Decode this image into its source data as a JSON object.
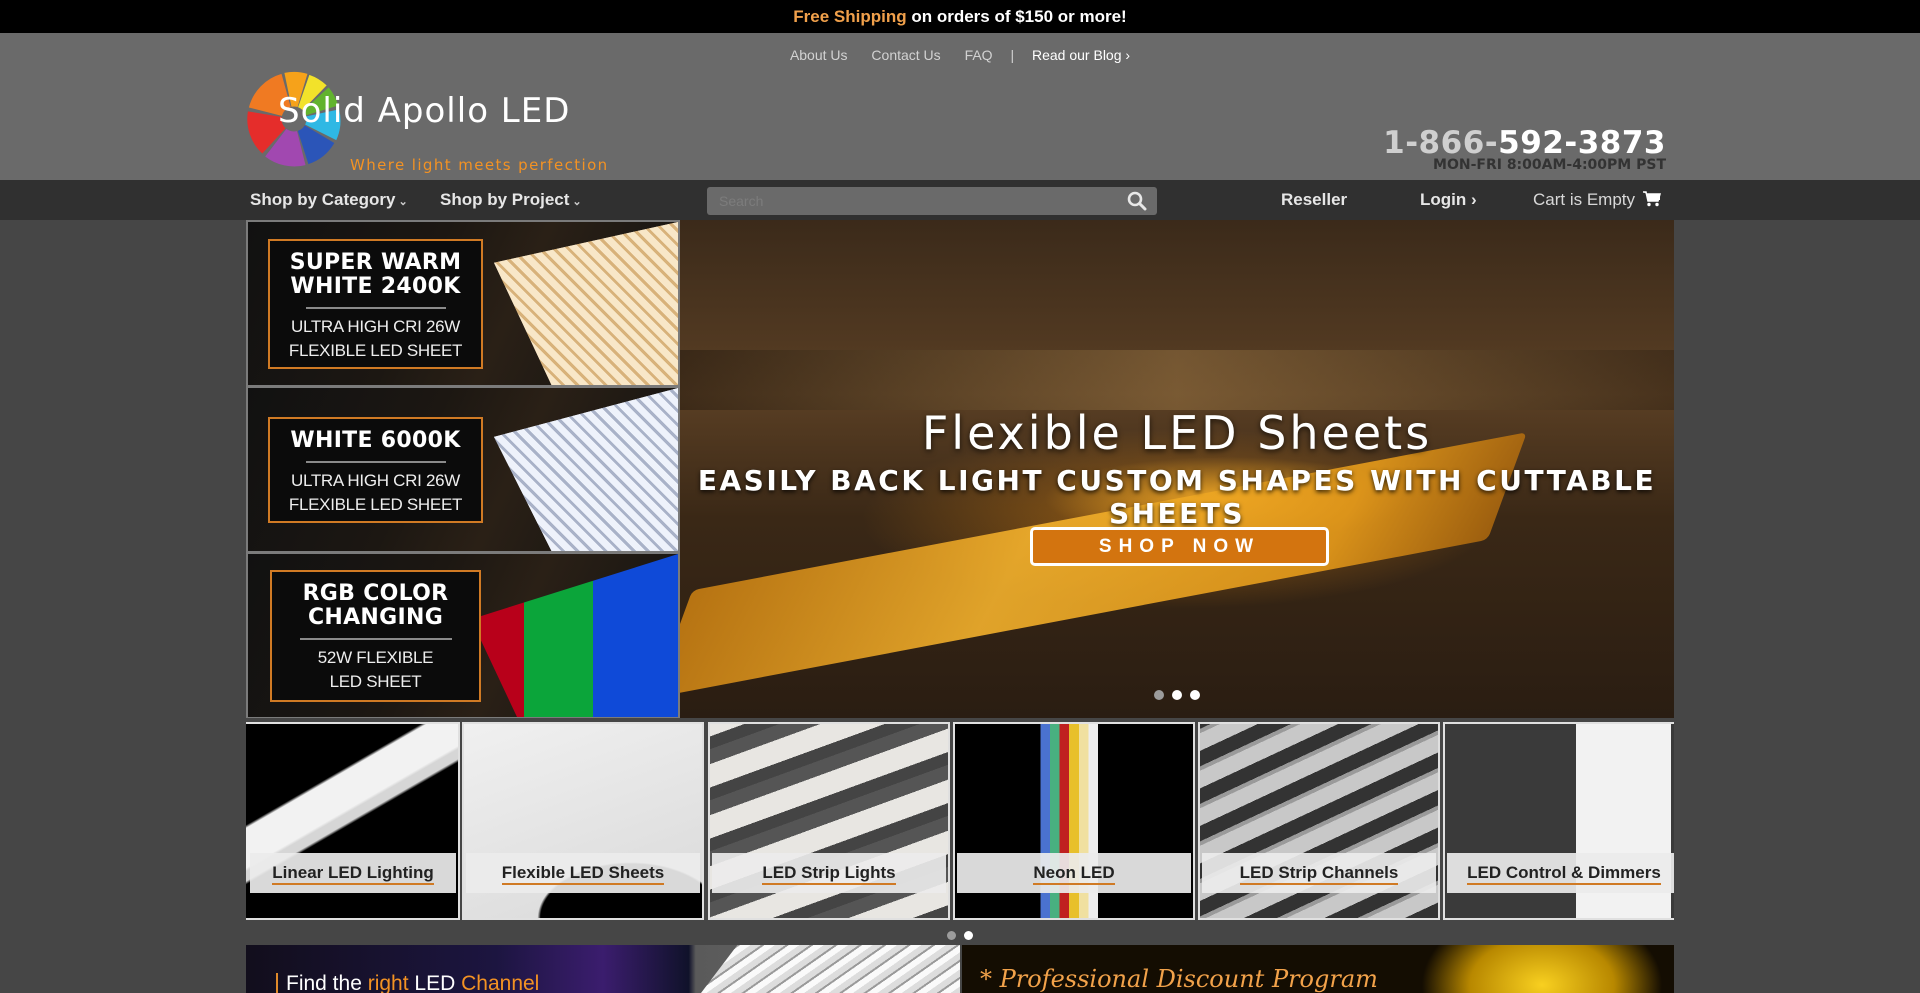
{
  "promo_bar": {
    "highlight": "Free Shipping",
    "text": " on orders of $150 or more!"
  },
  "top_links": [
    {
      "label": "About Us"
    },
    {
      "label": "Contact Us"
    },
    {
      "label": "FAQ"
    },
    {
      "label": "Read our Blog ›"
    }
  ],
  "logo": {
    "title": "Solid Apollo LED",
    "tagline": "Where light meets perfection"
  },
  "contact": {
    "phone_prefix": "1-866-",
    "phone_rest": "592-3873",
    "hours": "MON-FRI 8:00AM-4:00PM PST"
  },
  "nav": {
    "shop_by_category": "Shop by Category",
    "shop_by_project": "Shop by Project",
    "search_placeholder": "Search",
    "reseller": "Reseller",
    "login": "Login ›",
    "cart": "Cart is Empty",
    "icons": {
      "search": "search-icon",
      "cart": "cart-icon",
      "chevron": "chevron-down-icon"
    }
  },
  "side_banners": [
    {
      "title": "SUPER WARM WHITE 2400K",
      "line1": "ULTRA HIGH CRI 26W",
      "line2": "FLEXIBLE LED SHEET"
    },
    {
      "title": "WHITE 6000K",
      "line1": "ULTRA HIGH CRI 26W",
      "line2": "FLEXIBLE LED SHEET"
    },
    {
      "title": "RGB COLOR CHANGING",
      "line1": "52W FLEXIBLE",
      "line2": "LED SHEET"
    }
  ],
  "hero": {
    "title": "Flexible LED Sheets",
    "subtitle": "EASILY BACK LIGHT CUSTOM SHAPES WITH CUTTABLE SHEETS",
    "cta": "SHOP NOW",
    "slides": 3,
    "active_slide": 1
  },
  "categories": [
    {
      "label": "Linear LED Lighting"
    },
    {
      "label": "Flexible LED Sheets"
    },
    {
      "label": "LED Strip Lights"
    },
    {
      "label": "Neon LED"
    },
    {
      "label": "LED Strip Channels"
    },
    {
      "label": "LED Control & Dimmers"
    }
  ],
  "categories_carousel": {
    "pages": 2,
    "active_page": 1
  },
  "promos": {
    "left": {
      "pre": "Find the ",
      "hl1": "right",
      "mid": " LED ",
      "hl2": "Channel"
    },
    "right": {
      "prefix": "* ",
      "text": "Professional Discount Program"
    }
  },
  "colors": {
    "accent": "#f39223",
    "button": "#d3740f",
    "nav_bg": "#303030",
    "header_bg": "#6a6a6a"
  }
}
